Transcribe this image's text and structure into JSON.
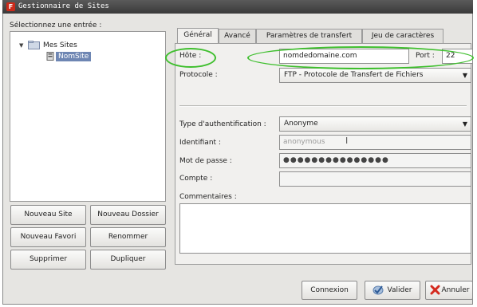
{
  "window": {
    "title": "Gestionnaire de Sites"
  },
  "tree": {
    "label": "Sélectionnez une entrée :",
    "root": "Mes Sites",
    "site": "NomSite"
  },
  "left_buttons": {
    "new_site": "Nouveau Site",
    "new_folder": "Nouveau Dossier",
    "new_bookmark": "Nouveau Favori",
    "rename": "Renommer",
    "delete": "Supprimer",
    "duplicate": "Dupliquer"
  },
  "tabs": [
    "Général",
    "Avancé",
    "Paramètres de transfert",
    "Jeu de caractères"
  ],
  "general": {
    "host_label": "Hôte :",
    "host_value": "nomdedomaine.com",
    "port_label": "Port :",
    "port_value": "22",
    "protocol_label": "Protocole :",
    "protocol_value": "FTP - Protocole de Transfert de Fichiers",
    "auth_label": "Type d'authentification :",
    "auth_value": "Anonyme",
    "user_label": "Identifiant :",
    "user_value": "anonymous",
    "password_label": "Mot de passe :",
    "password_value": "●●●●●●●●●●●●●●●",
    "account_label": "Compte :",
    "account_value": "",
    "comments_label": "Commentaires :"
  },
  "footer": {
    "connect": "Connexion",
    "ok": "Valider",
    "cancel": "Annuler"
  },
  "colors": {
    "annotation": "#3fbf2e",
    "selection": "#6e86b3"
  }
}
